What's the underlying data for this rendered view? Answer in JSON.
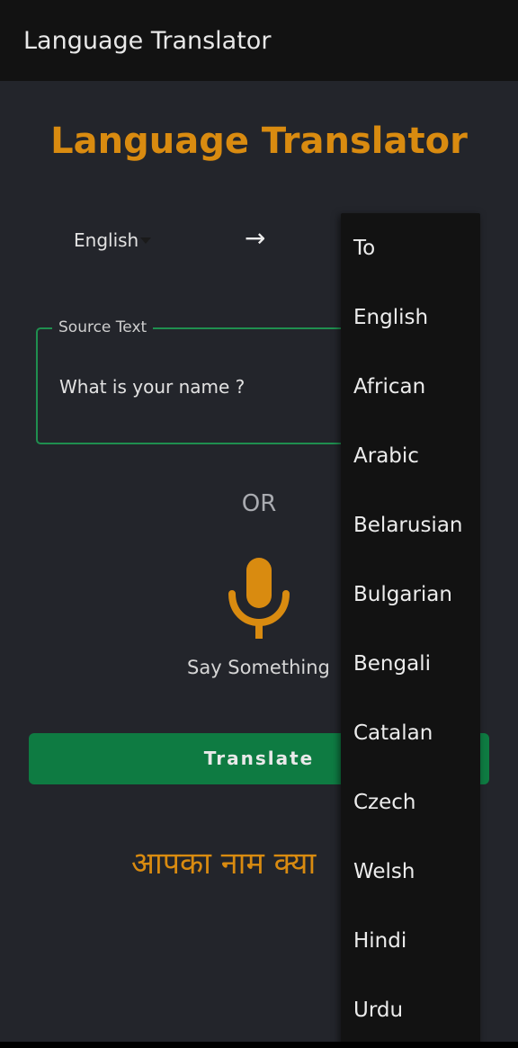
{
  "app_bar": {
    "title": "Language Translator"
  },
  "page": {
    "title": "Language Translator"
  },
  "language_selector": {
    "from_value": "English",
    "arrow_icon": "arrow-right-icon"
  },
  "source": {
    "label": "Source Text",
    "value": "What is your name ?"
  },
  "or_text": "OR",
  "voice": {
    "icon": "microphone-icon",
    "label": "Say Something"
  },
  "translate_button": {
    "label": "Translate"
  },
  "result": {
    "text": "आपका नाम क्या"
  },
  "dropdown": {
    "items": [
      {
        "label": "To"
      },
      {
        "label": "English"
      },
      {
        "label": "African"
      },
      {
        "label": "Arabic"
      },
      {
        "label": "Belarusian"
      },
      {
        "label": "Bulgarian"
      },
      {
        "label": "Bengali"
      },
      {
        "label": "Catalan"
      },
      {
        "label": "Czech"
      },
      {
        "label": "Welsh"
      },
      {
        "label": "Hindi"
      },
      {
        "label": "Urdu"
      }
    ]
  },
  "colors": {
    "background": "#23252b",
    "app_bar": "#121212",
    "accent_orange": "#d98b10",
    "accent_green": "#0e7b42",
    "outline_green": "#1f8f4f",
    "menu_background": "#121212"
  }
}
